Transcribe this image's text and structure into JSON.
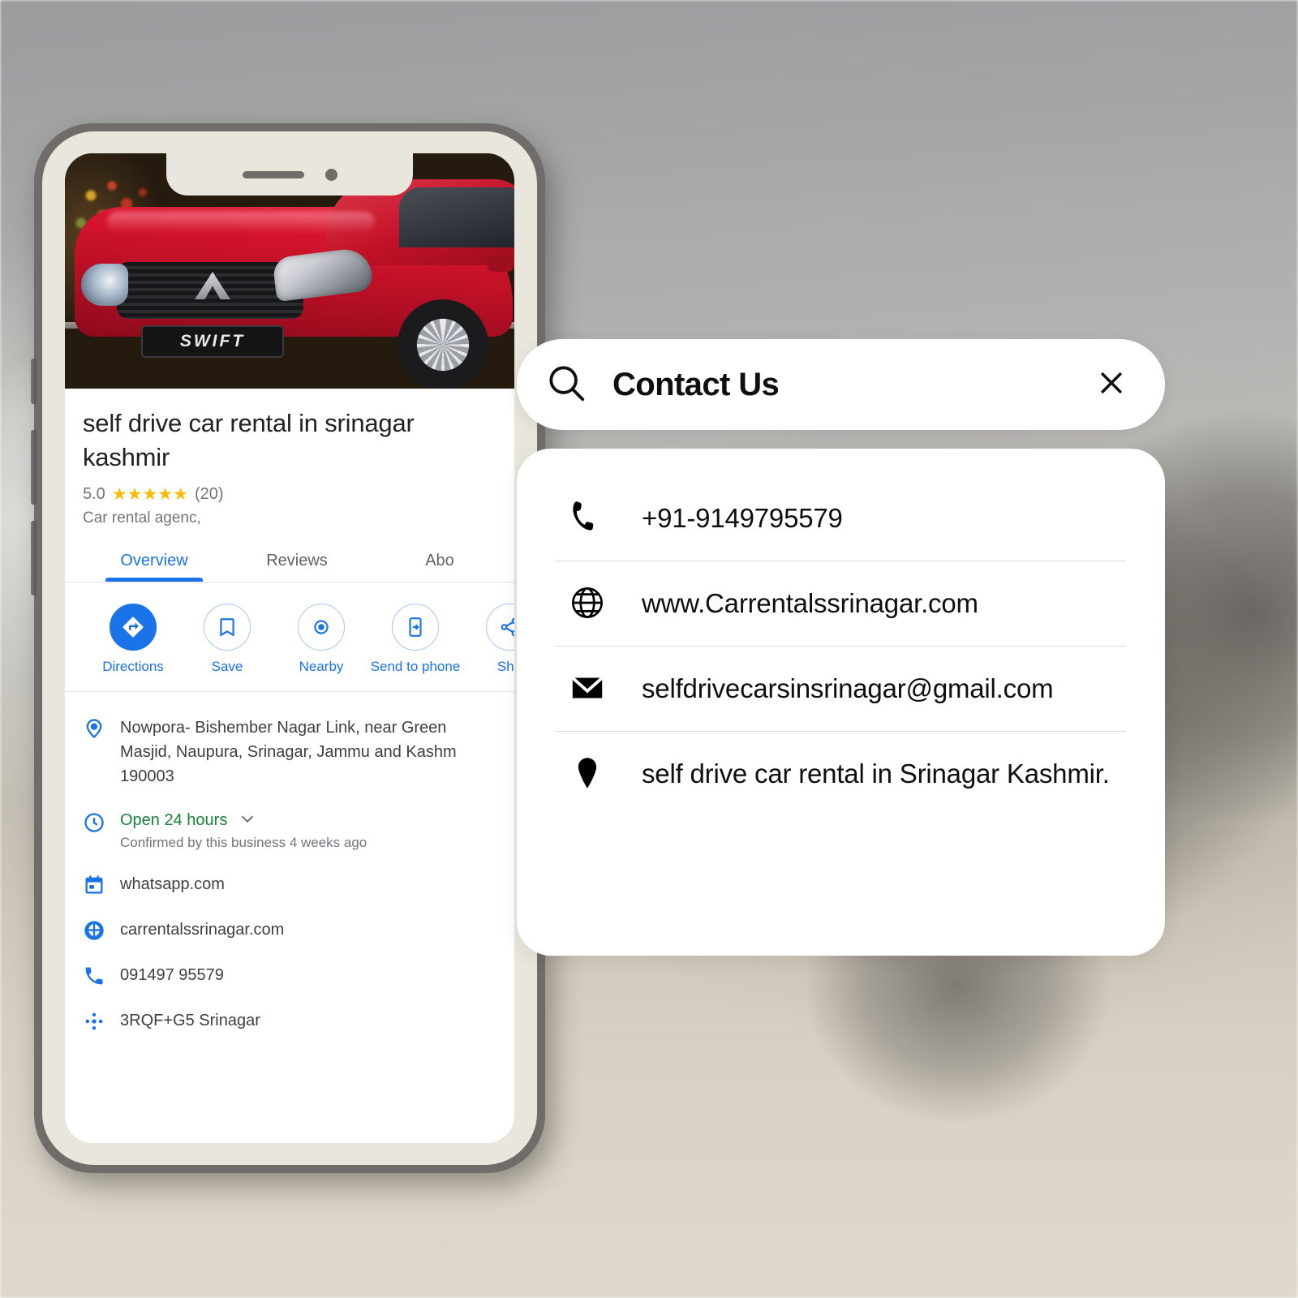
{
  "background": {
    "description": "blurred hazy photo of a dark SUV on gravel ground",
    "sky_color": "#a4a6a6",
    "ground_color": "#d9d3c7"
  },
  "phone_mockup": {
    "frame_color": "#6f6c69",
    "inner_color": "#e9e6de",
    "hero_image": {
      "alt": "red Maruti Suzuki Swift car",
      "badge_text": "SWIFT",
      "car_color": "#d5142c"
    },
    "listing": {
      "title": "self drive car rental in srinagar kashmir",
      "rating_value": "5.0",
      "stars": "★★★★★",
      "review_count": "(20)",
      "category": "Car rental agenc,",
      "accent_color": "#1a73e8",
      "star_color": "#fabb05",
      "tabs": [
        {
          "label": "Overview",
          "active": true
        },
        {
          "label": "Reviews",
          "active": false
        },
        {
          "label": "Abo",
          "active": false
        }
      ],
      "actions": [
        {
          "label": "Directions",
          "icon": "directions-icon",
          "primary": true
        },
        {
          "label": "Save",
          "icon": "bookmark-icon",
          "primary": false
        },
        {
          "label": "Nearby",
          "icon": "nearby-icon",
          "primary": false
        },
        {
          "label": "Send to phone",
          "icon": "send-to-phone-icon",
          "primary": false
        },
        {
          "label": "Sha",
          "icon": "share-icon",
          "primary": false
        }
      ],
      "details": {
        "address": "Nowpora- Bishember Nagar Link, near Green Masjid, Naupura, Srinagar, Jammu and Kashm 190003",
        "hours_status": "Open 24 hours",
        "hours_confirmed": "Confirmed by this business 4 weeks ago",
        "hours_status_color": "#188038",
        "whatsapp": "whatsapp.com",
        "website": "carrentalssrinagar.com",
        "phone": "091497 95579",
        "plus_code": "3RQF+G5 Srinagar"
      }
    }
  },
  "contact_panel": {
    "search_icon": "search-icon",
    "title": "Contact Us",
    "close_icon": "close-icon",
    "rows": [
      {
        "icon": "phone-icon",
        "text": "+91-9149795579"
      },
      {
        "icon": "globe-icon",
        "text": "www.Carrentalssrinagar.com"
      },
      {
        "icon": "email-icon",
        "text": "selfdrivecarsinsrinagar@gmail.com"
      },
      {
        "icon": "location-pin-icon",
        "text": "self drive car rental in Srinagar Kashmir."
      }
    ]
  }
}
